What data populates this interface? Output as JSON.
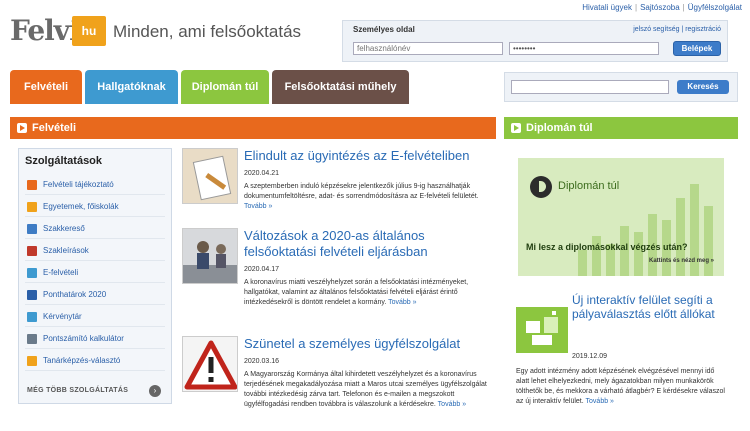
{
  "toplinks": [
    "Hivatali ügyek",
    "Sajtószoba",
    "Ügyfélszolgálat"
  ],
  "logo": {
    "felvi": "Felvi",
    "hu": "hu"
  },
  "tagline": "Minden, ami felsőoktatás",
  "login": {
    "title": "Személyes oldal",
    "links": "jelszó segítség | regisztráció",
    "username_placeholder": "felhasználónév",
    "password_value": "••••••••",
    "button": "Belépek"
  },
  "nav": {
    "felveteli": "Felvételi",
    "hallgatoknak": "Hallgatóknak",
    "diploman": "Diplomán túl",
    "muhely": "Felsőoktatási műhely"
  },
  "search": {
    "button": "Keresés"
  },
  "sections": {
    "felveteli": "Felvételi",
    "diploman": "Diplomán túl"
  },
  "services": {
    "title": "Szolgáltatások",
    "items": [
      {
        "label": "Felvételi tájékoztató",
        "color": "#e8691d"
      },
      {
        "label": "Egyetemek, főiskolák",
        "color": "#f0a21b"
      },
      {
        "label": "Szakkereső",
        "color": "#3e7cc4"
      },
      {
        "label": "Szakleírások",
        "color": "#c0392b"
      },
      {
        "label": "E-felvételi",
        "color": "#3e9ad0"
      },
      {
        "label": "Ponthatárok 2020",
        "color": "#2a5fa8"
      },
      {
        "label": "Kérvénytár",
        "color": "#3e9ad0"
      },
      {
        "label": "Pontszámító kalkulátor",
        "color": "#6a7a8a"
      },
      {
        "label": "Tanárképzés-választó",
        "color": "#f0a21b"
      }
    ],
    "more": "MÉG TÖBB SZOLGÁLTATÁS"
  },
  "articles": [
    {
      "title": "Elindult az ügyintézés az E-felvételiben",
      "date": "2020.04.21",
      "body": "A szeptemberben induló képzésekre jelentkezők július 9-ig használhatják dokumentumfeltöltésre, adat- és sorrendmódosításra az E-felvételi felületét.",
      "more": "Tovább »"
    },
    {
      "title": "Változások a 2020-as általános felsőoktatási felvételi eljárásban",
      "date": "2020.04.17",
      "body": "A koronavírus miatti veszélyhelyzet során a felsőoktatási intézményeket, hallgatókat, valamint az általános felsőoktatási felvételi eljárást érintő intézkedésekről is döntött rendelet a kormány.",
      "more": "Tovább »"
    },
    {
      "title": "Szünetel a személyes ügyfélszolgálat",
      "date": "2020.03.16",
      "body": "A Magyarország Kormánya által kihirdetett veszélyhelyzet és a koronavírus terjedésének megakadályozása miatt a Maros utcai személyes ügyfélszolgálat további intézkedésig zárva tart. Telefonon és e-mailen a megszokott ügyfélfogadási rendben továbbra is válaszolunk a kérdésekre.",
      "more": "Tovább »"
    }
  ],
  "dipl_banner": {
    "title": "Diplomán túl",
    "question": "Mi lesz a diplomásokkal végzés után?",
    "cta": "Kattints és nézd meg »"
  },
  "right_article": {
    "title": "Új interaktív felület segíti a pályaválasztás előtt állókat",
    "date": "2019.12.09",
    "body": "Egy adott intézmény adott képzésének elvégzésével mennyi idő alatt lehet elhelyezkedni, mely ágazatokban milyen munkakörök tölthetők be, és mekkora a várható átlagbér? E kérdésekre válaszol az új interaktív felület.",
    "more": "Tovább »"
  }
}
